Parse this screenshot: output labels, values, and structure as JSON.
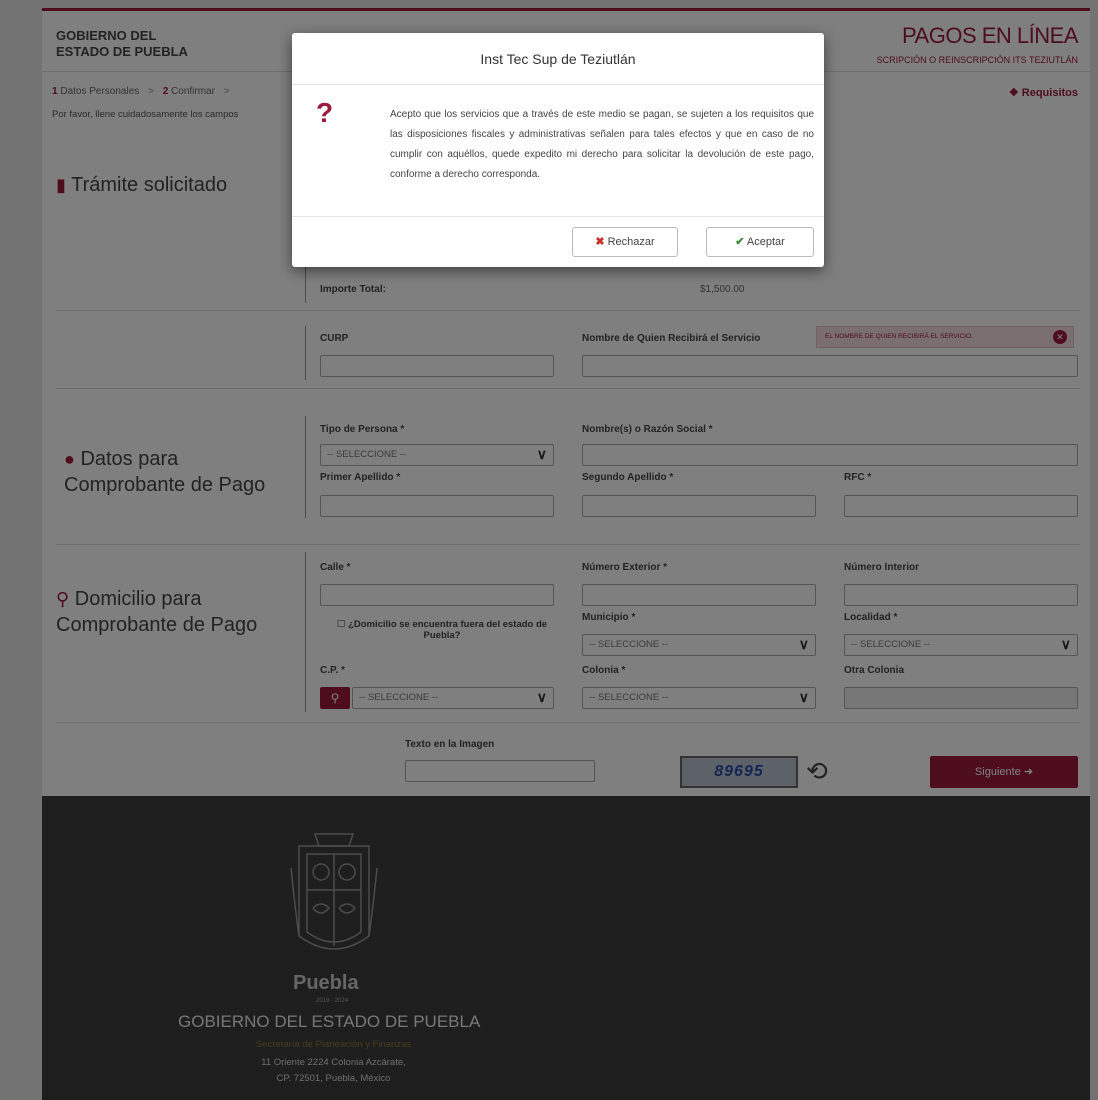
{
  "header": {
    "gov_line1": "GOBIERNO DEL",
    "gov_line2": "ESTADO DE PUEBLA",
    "title": "PAGOS EN LÍNEA",
    "subtitle": "SCRIPCIÓN O REINSCRIPCIÓN ITS TEZIUTLÁN"
  },
  "steps": {
    "step1_num": "1",
    "step1_label": "Datos Personales",
    "step2_num": "2",
    "step2_label": "Confirmar",
    "requisitos": "Requisitos"
  },
  "instructions": "Por favor, llene cuidadosamente los campos",
  "tramite": {
    "title": "Trámite solicitado",
    "importe_label": "Importe Total:",
    "importe_value": "$1,500.00"
  },
  "servicio": {
    "curp_label": "CURP",
    "nombre_label": "Nombre de Quien Recibirá el Servicio",
    "error": "EL NOMBRE DE QUIEN RECIBIRÁ EL SERVICIO."
  },
  "comprobante": {
    "title_line1": "Datos para",
    "title_line2": "Comprobante de Pago",
    "tipo_persona_label": "Tipo de Persona *",
    "tipo_persona_value": "-- SELECCIONE --",
    "nombre_label": "Nombre(s) o Razón Social *",
    "primer_apellido_label": "Primer Apellido *",
    "segundo_apellido_label": "Segundo Apellido *",
    "rfc_label": "RFC *"
  },
  "domicilio": {
    "title_line1": "Domicilio para",
    "title_line2": "Comprobante de Pago",
    "calle_label": "Calle *",
    "num_ext_label": "Número Exterior *",
    "num_int_label": "Número Interior",
    "fuera_label": "¿Domicilio se encuentra fuera del estado de Puebla?",
    "municipio_label": "Municipio *",
    "municipio_value": "-- SELECCIONE --",
    "localidad_label": "Localidad *",
    "localidad_value": "-- SELECCIONE --",
    "cp_label": "C.P. *",
    "cp_value": "-- SELECCIONE --",
    "colonia_label": "Colonia *",
    "colonia_value": "-- SELECCIONE --",
    "otra_colonia_label": "Otra Colonia"
  },
  "captcha": {
    "label": "Texto en la Imagen",
    "code": "89695",
    "next_label": "Siguiente"
  },
  "footer": {
    "puebla": "Puebla",
    "years": "2019 - 2024",
    "title": "GOBIERNO DEL ESTADO DE PUEBLA",
    "secretaria": "Secretaría de Planeación y Finanzas",
    "address1": "11 Oriente 2224 Colonia Azcárate,",
    "address2": "CP. 72501, Puebla, México"
  },
  "modal": {
    "title": "Inst Tec Sup de Teziutlán",
    "body": "Acepto que los servicios que a través de este medio se pagan, se sujeten a los requisitos que las disposiciones fiscales y administrativas señalen para tales efectos y que en caso de no cumplir con aquéllos, quede expedito mi derecho para solicitar la devolución de este pago, conforme a derecho corresponda.",
    "reject_label": "Rechazar",
    "accept_label": "Aceptar"
  },
  "colors": {
    "brand": "#9b1b3a",
    "footer_bg": "#3c3c3c"
  }
}
